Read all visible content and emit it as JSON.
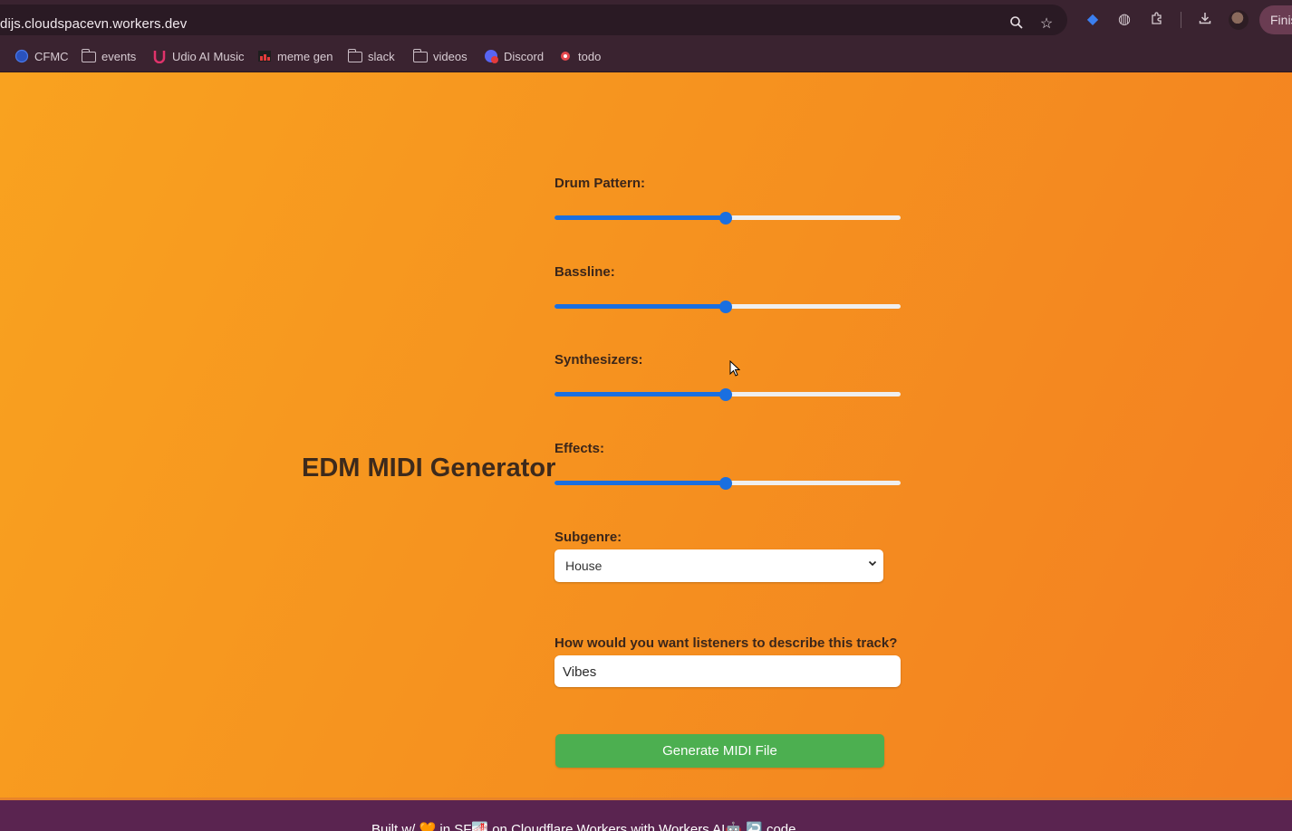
{
  "browser": {
    "url": "dijs.cloudspacevn.workers.dev",
    "finish_label": "Finis",
    "toolbar_icons": [
      "zoom-icon",
      "star-icon",
      "extension-gem-icon",
      "extension-globe-icon",
      "puzzle-icon",
      "download-icon",
      "profile-avatar"
    ]
  },
  "bookmarks": [
    {
      "label": "CFMC",
      "icon": "cfmc-icon"
    },
    {
      "label": "events",
      "icon": "folder-icon"
    },
    {
      "label": "Udio AI Music",
      "icon": "udio-icon"
    },
    {
      "label": "meme gen",
      "icon": "imgflip-icon"
    },
    {
      "label": "slack",
      "icon": "folder-icon"
    },
    {
      "label": "videos",
      "icon": "folder-icon"
    },
    {
      "label": "Discord",
      "icon": "discord-icon"
    },
    {
      "label": "todo",
      "icon": "todo-icon"
    }
  ],
  "page": {
    "title": "EDM MIDI Generator",
    "sliders": [
      {
        "label": "Drum Pattern:",
        "value": 0.5
      },
      {
        "label": "Bassline:",
        "value": 0.5
      },
      {
        "label": "Synthesizers:",
        "value": 0.5
      },
      {
        "label": "Effects:",
        "value": 0.5
      }
    ],
    "subgenre": {
      "label": "Subgenre:",
      "selected": "House"
    },
    "describe": {
      "label": "How would you want listeners to describe this track?",
      "value": "Vibes"
    },
    "generate_label": "Generate MIDI File"
  },
  "footer": {
    "text": "Built w/ 🧡 in SF🌁 on Cloudflare Workers with Workers AI🤖 ↩️ code"
  },
  "colors": {
    "accent": "#1a6fe0",
    "button": "#4caf50",
    "page_bg": "#f7931e",
    "footer_bg": "#5a2450"
  }
}
